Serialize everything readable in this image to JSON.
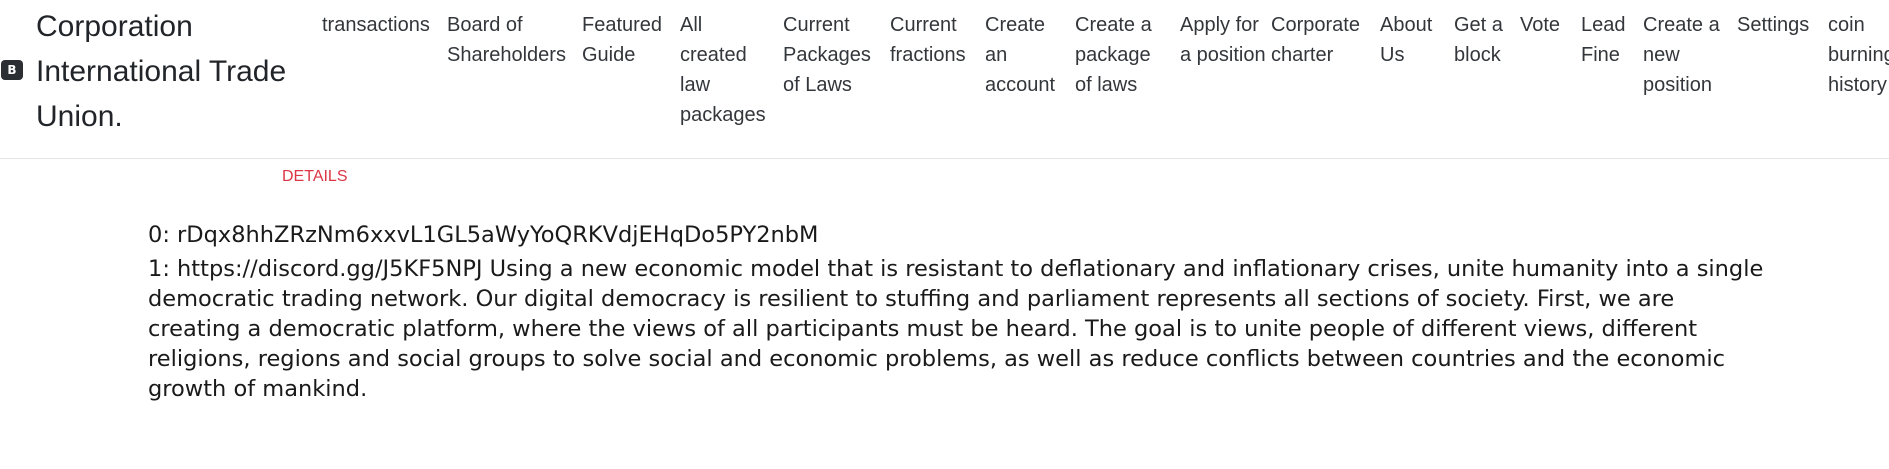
{
  "brand": {
    "icon_letter": "B",
    "name": "Corporation International Trade Union."
  },
  "nav": {
    "items": [
      "transactions",
      "Board of Shareholders",
      "Featured Guide",
      "All created law packages",
      "Current Packages of Laws",
      "Current fractions",
      "Create an account",
      "Create a package of laws",
      "Apply for a position",
      "Corporate charter",
      "About Us",
      "Get a block",
      "Vote",
      "Lead Fine",
      "Create a new position",
      "Settings",
      "coin burning history"
    ]
  },
  "details_link": "DETAILS",
  "content": {
    "line0": "0: rDqx8hhZRzNm6xxvL1GL5aWyYoQRKVdjEHqDo5PY2nbM",
    "line1": "1: https://discord.gg/J5KF5NPJ Using a new economic model that is resistant to deflationary and inflationary crises, unite humanity into a single democratic trading network. Our digital democracy is resilient to stuffing and parliament represents all sections of society. First, we are creating a democratic platform, where the views of all participants must be heard. The goal is to unite people of different views, different religions, regions and social groups to solve social and economic problems, as well as reduce conflicts between countries and the economic growth of mankind."
  },
  "colors": {
    "details_link": "#dc3545",
    "brand_icon_bg": "#2b2f33",
    "nav_border": "#e5e5e5"
  }
}
